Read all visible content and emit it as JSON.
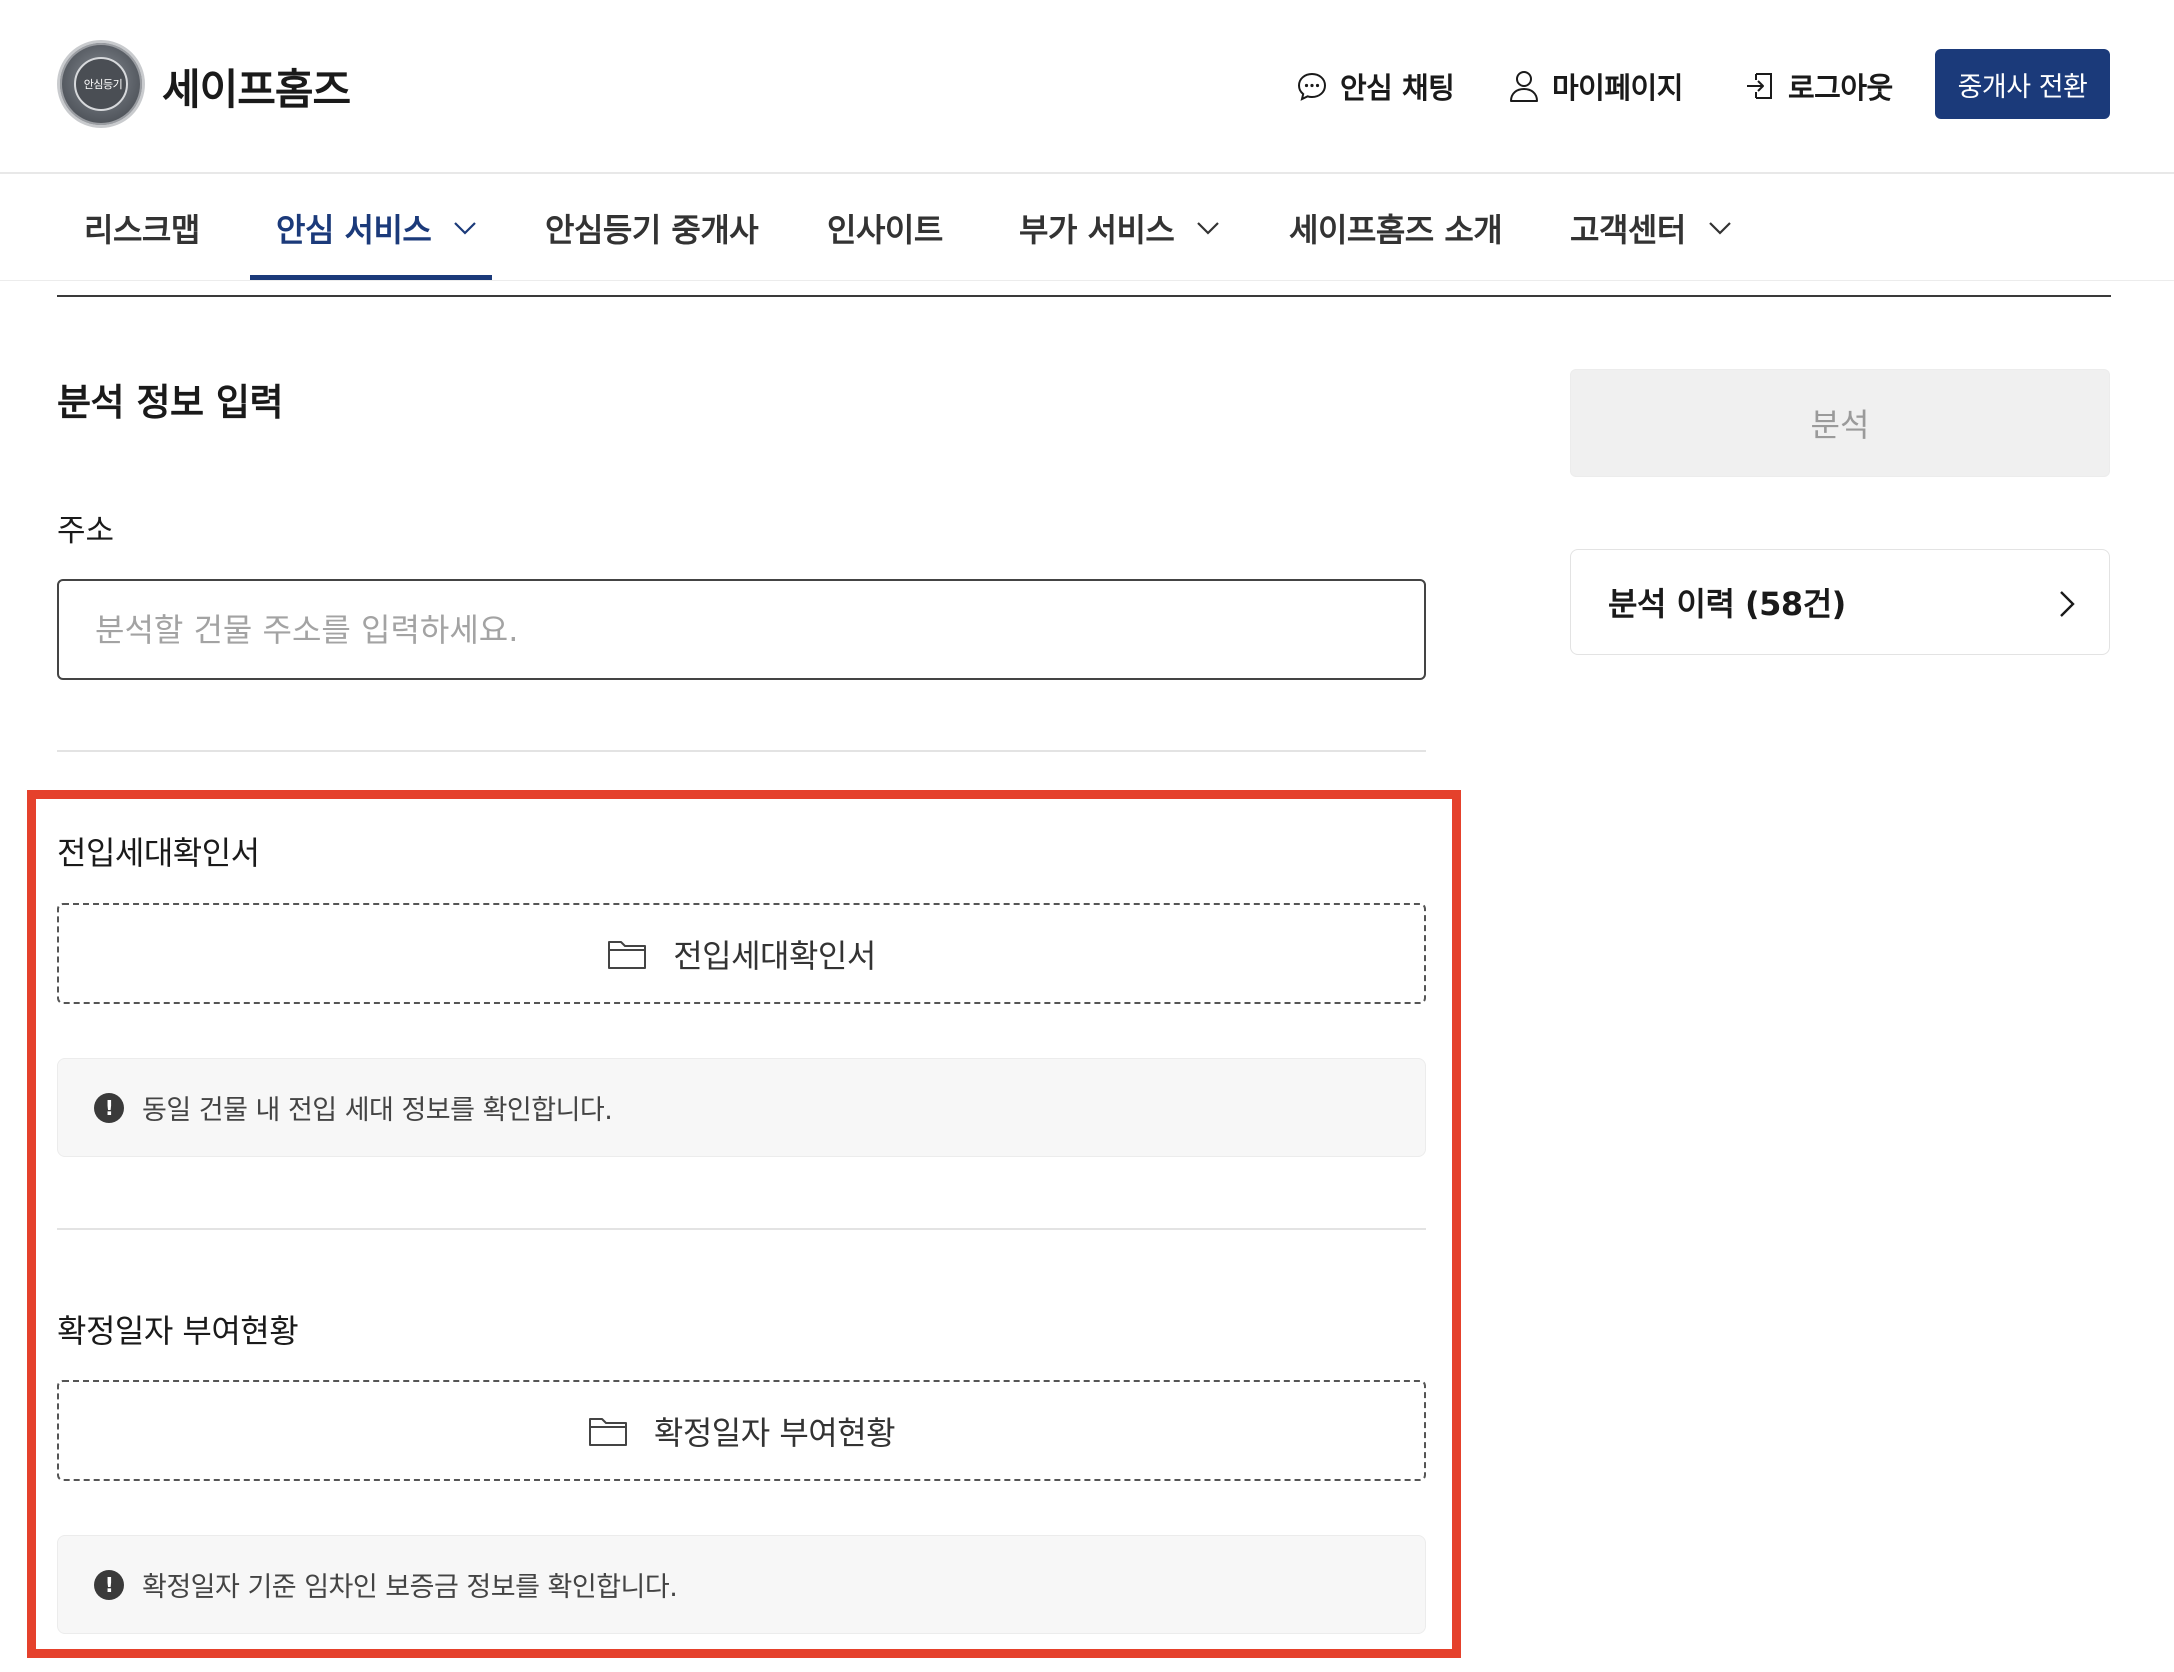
{
  "header": {
    "logo_text": "안심등기",
    "brand": "세이프홈즈",
    "links": {
      "chat": "안심 채팅",
      "mypage": "마이페이지",
      "logout": "로그아웃"
    },
    "switch_button": "중개사 전환"
  },
  "nav": {
    "items": [
      {
        "label": "리스크맵"
      },
      {
        "label": "안심 서비스"
      },
      {
        "label": "안심등기 중개사"
      },
      {
        "label": "인사이트"
      },
      {
        "label": "부가 서비스"
      },
      {
        "label": "세이프홈즈 소개"
      },
      {
        "label": "고객센터"
      }
    ],
    "active_index": 1
  },
  "main": {
    "section_title": "분석 정보 입력",
    "address": {
      "label": "주소",
      "placeholder": "분석할 건물 주소를 입력하세요.",
      "value": ""
    },
    "documents": [
      {
        "title": "전입세대확인서",
        "upload_label": "전입세대확인서",
        "notice": "동일 건물 내 전입 세대 정보를 확인합니다."
      },
      {
        "title": "확정일자 부여현황",
        "upload_label": "확정일자 부여현황",
        "notice": "확정일자 기준 임차인 보증금 정보를 확인합니다."
      }
    ]
  },
  "side": {
    "analyze_button": "분석",
    "history_label": "분석 이력 (58건)"
  },
  "colors": {
    "brand_navy": "#1b3a7a",
    "highlight_red": "#e5412c",
    "disabled_bg": "#f0f0f0",
    "notice_bg": "#f7f7f7"
  },
  "icons": [
    "logo-icon",
    "chat-icon",
    "user-icon",
    "logout-icon",
    "chevron-down-icon",
    "folder-icon",
    "alert-icon",
    "chevron-right-icon"
  ]
}
